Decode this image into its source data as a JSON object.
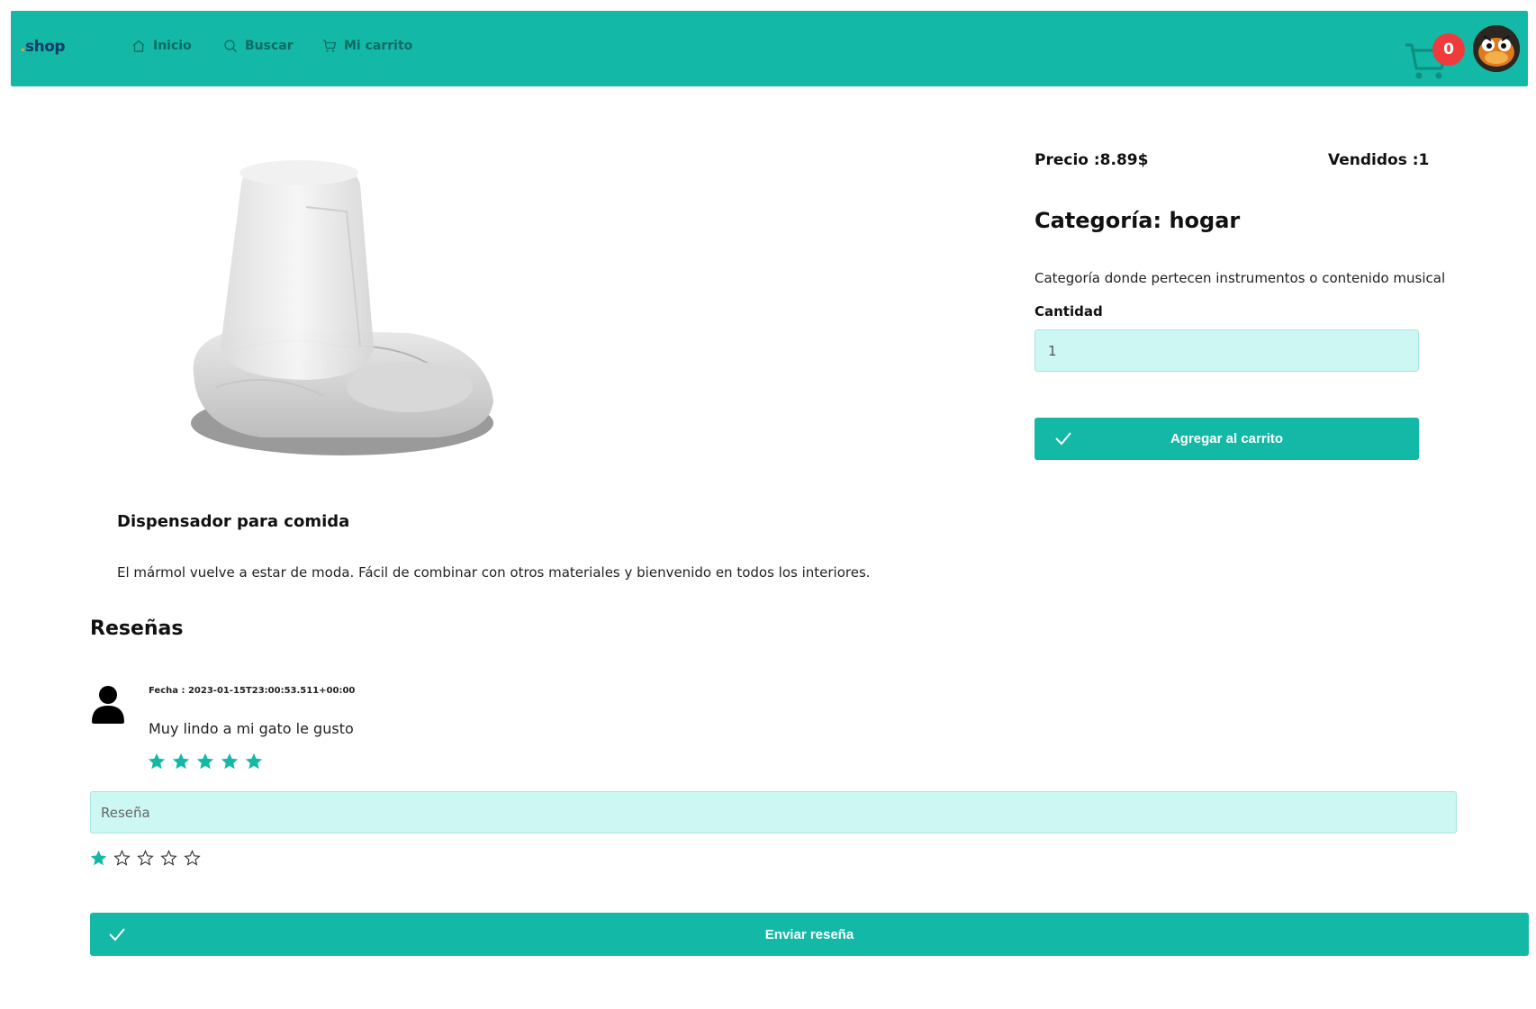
{
  "header": {
    "logo_dot": ".",
    "logo_text": "shop",
    "nav": [
      {
        "label": "Inicio",
        "icon": "home-icon"
      },
      {
        "label": "Buscar",
        "icon": "search-icon"
      },
      {
        "label": "Mi carrito",
        "icon": "cart-icon"
      }
    ],
    "cart_count": "0",
    "colors": {
      "bar": "#14b8a6",
      "badge": "#ef3b3b",
      "accent": "#14b8a6",
      "input_bg": "#ccf7f2"
    }
  },
  "product": {
    "price": "Precio :8.89$",
    "sold": "Vendidos :1",
    "category": "Categoría: hogar",
    "category_description": "Categoría donde pertecen instrumentos o contenido musical",
    "quantity_label": "Cantidad",
    "quantity_value": "1",
    "add_to_cart_label": "Agregar al carrito",
    "name": "Dispensador para comida",
    "description": "El mármol vuelve a estar de moda. Fácil de combinar con otros materiales y bienvenido en todos los interiores."
  },
  "reviews": {
    "title": "Reseñas",
    "items": [
      {
        "date": "Fecha : 2023-01-15T23:00:53.511+00:00",
        "text": "Muy lindo a mi gato le gusto",
        "rating": 5
      }
    ],
    "form": {
      "placeholder": "Reseña",
      "rating": 1,
      "max_rating": 5,
      "submit_label": "Enviar reseña"
    }
  }
}
